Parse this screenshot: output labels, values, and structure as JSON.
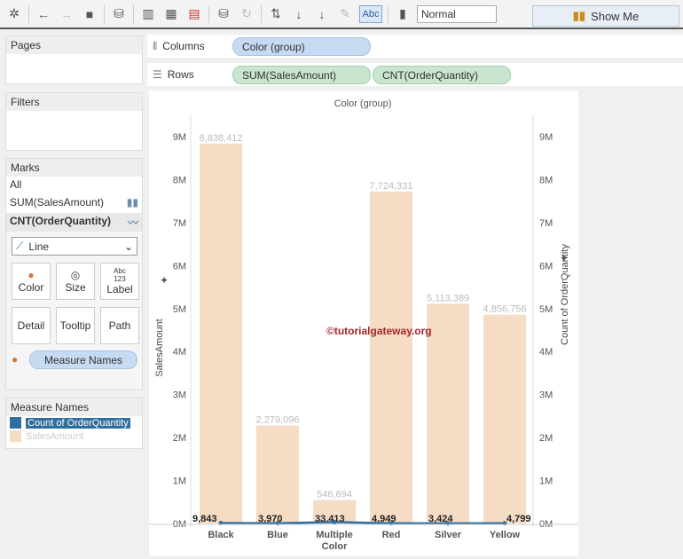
{
  "toolbar": {
    "zoom_value": "Normal",
    "show_me": "Show Me",
    "abc": "Abc"
  },
  "pages": {
    "title": "Pages"
  },
  "filters": {
    "title": "Filters"
  },
  "marks": {
    "title": "Marks",
    "all": "All",
    "measure1": "SUM(SalesAmount)",
    "measure2": "CNT(OrderQuantity)",
    "mark_type": "Line",
    "buttons": [
      "Color",
      "Size",
      "Label",
      "Detail",
      "Tooltip",
      "Path"
    ],
    "label_icon": "Abc 123",
    "color_pill": "Measure Names"
  },
  "legend": {
    "title": "Measure Names",
    "items": [
      {
        "label": "Count of OrderQuantity",
        "color": "#2f6f9f"
      },
      {
        "label": "SalesAmount",
        "color": "#f5dcc4"
      }
    ]
  },
  "shelves": {
    "columns_label": "Columns",
    "columns_pill": "Color (group)",
    "rows_label": "Rows",
    "rows_pills": [
      "SUM(SalesAmount)",
      "CNT(OrderQuantity)"
    ]
  },
  "watermark": "©tutorialgateway.org",
  "chart_data": {
    "type": "bar",
    "title": "Color (group)",
    "categories": [
      "Black",
      "Blue",
      "Multiple Color",
      "Red",
      "Silver",
      "Yellow"
    ],
    "series": [
      {
        "name": "SalesAmount",
        "type": "bar",
        "values": [
          8838412,
          2279096,
          546694,
          7724331,
          5113389,
          4856756
        ],
        "labels": [
          "8,838,412",
          "2,279,096",
          "546,694",
          "7,724,331",
          "5,113,389",
          "4,856,756"
        ],
        "color": "#f5dcc4"
      },
      {
        "name": "Count of OrderQuantity",
        "type": "line",
        "values": [
          9843,
          3970,
          33413,
          4949,
          3424,
          4799
        ],
        "labels": [
          "9,843",
          "3,970",
          "33,413",
          "4,949",
          "3,424",
          "4,799"
        ],
        "color": "#2f6f9f"
      }
    ],
    "ylabel": "SalesAmount",
    "y2label": "Count of OrderQuantity",
    "ylim": [
      0,
      9000000
    ],
    "yticks": [
      "0M",
      "1M",
      "2M",
      "3M",
      "4M",
      "5M",
      "6M",
      "7M",
      "8M",
      "9M"
    ]
  }
}
